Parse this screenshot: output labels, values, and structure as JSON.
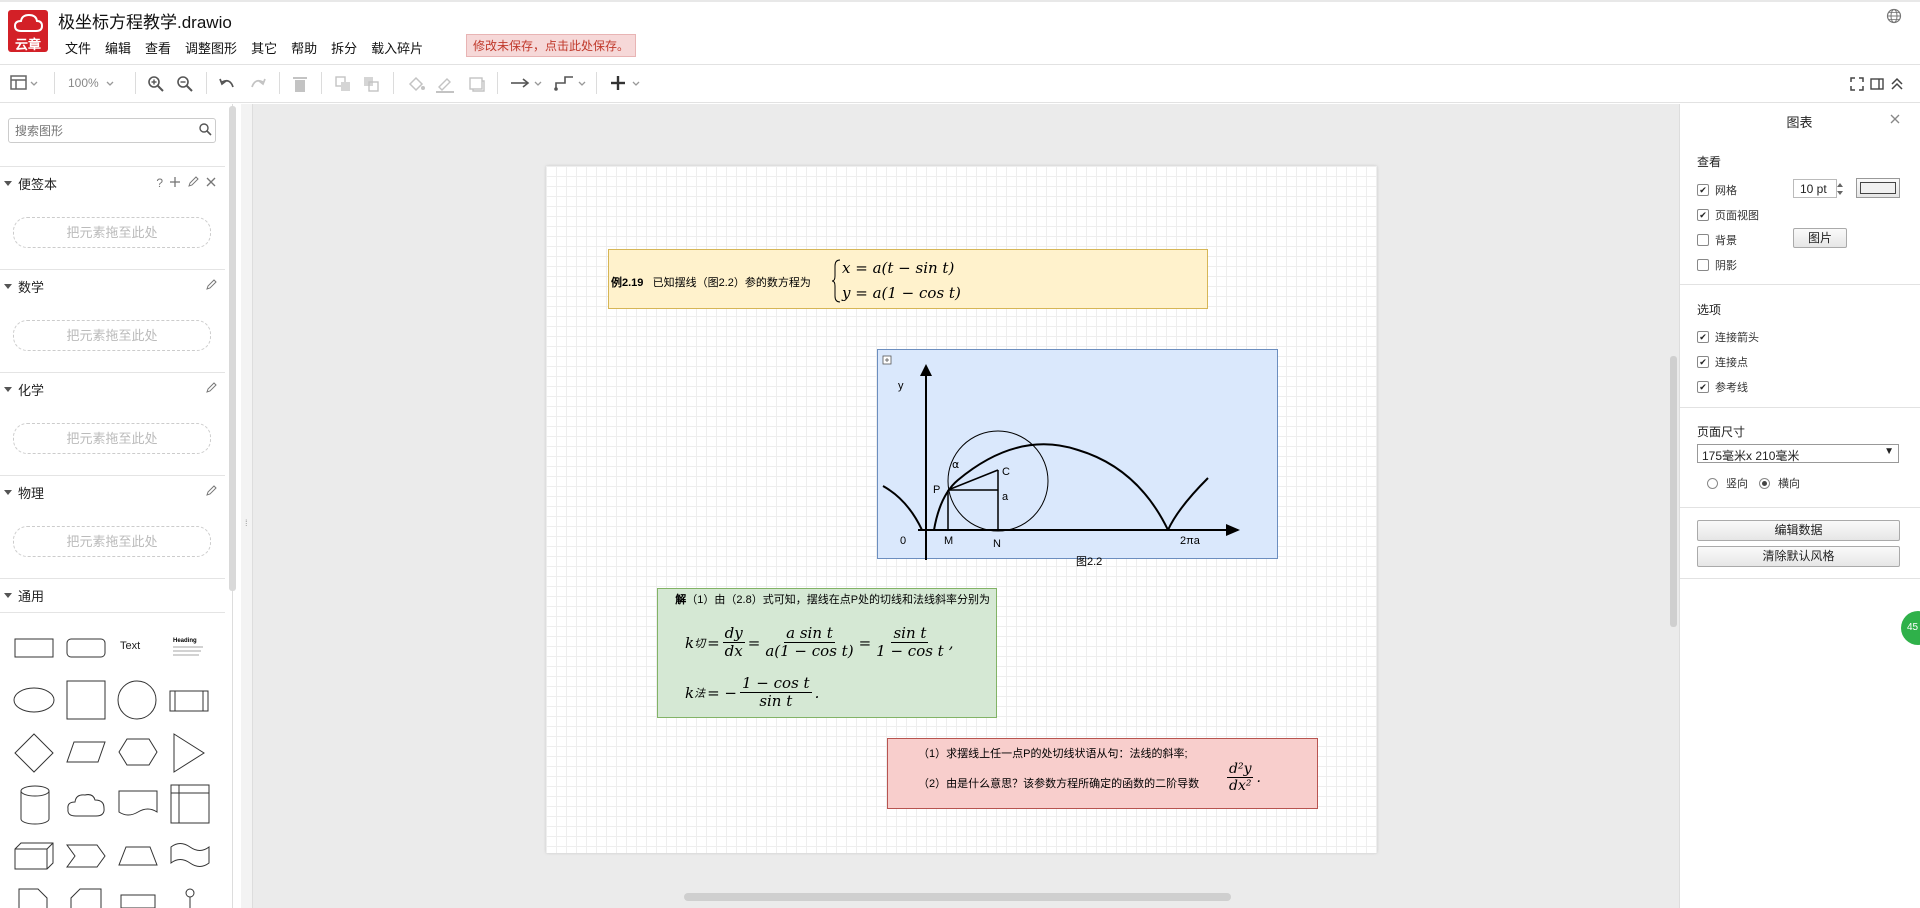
{
  "app": {
    "logo_text": "云章",
    "title": "极坐标方程教学.drawio",
    "unsaved_notice": "修改未保存，点击此处保存。"
  },
  "menu": [
    "文件",
    "编辑",
    "查看",
    "调整图形",
    "其它",
    "帮助",
    "拆分",
    "载入碎片"
  ],
  "toolbar": {
    "zoom": "100%"
  },
  "sidebar": {
    "search_placeholder": "搜索图形",
    "drop_text": "把元素拖至此处",
    "sections": {
      "scratchpad": "便签本",
      "math": "数学",
      "chemistry": "化学",
      "physics": "物理",
      "general": "通用"
    },
    "scratchpad_help": "?",
    "shape_text": "Text",
    "shape_heading": "Heading"
  },
  "diagram": {
    "example": {
      "label": "例2.19",
      "text": "已知摆线（图2.2）参的数方程为",
      "eq1": "x = a(t − sin t)",
      "eq2": "y = a(1 − cos t)"
    },
    "figure": {
      "caption": "图2.2",
      "y_label": "y",
      "origin": "0",
      "m": "M",
      "n": "N",
      "p": "P",
      "c": "C",
      "a": "a",
      "alpha": "α",
      "two_pi_a": "2πa"
    },
    "solution": {
      "lead": "解",
      "text": "（1）由（2.8）式可知，摆线在点P处的切线和法线斜率分别为",
      "k1": "k",
      "k1_sub": "切",
      "k2_sub": "法",
      "dy": "dy",
      "dx": "dx",
      "asint": "a sin t",
      "a1cost": "a(1 − cos t)",
      "sint": "sin t",
      "onecost": "1 − cos t",
      "onecost2": "1 − cos t",
      "sint2": "sin t"
    },
    "questions": {
      "q1": "（1）求摆线上任一点P的处切线状语从句：法线的斜率;",
      "q2": "（2）由是什么意思？该参数方程所确定的函数的二阶导数",
      "d2y": "d²y",
      "dx2": "dx²"
    }
  },
  "right_panel": {
    "title": "图表",
    "view_header": "查看",
    "grid": "网格",
    "grid_size": "10 pt",
    "page_view": "页面视图",
    "background": "背景",
    "image_btn": "图片",
    "shadow": "阴影",
    "options_header": "选项",
    "connection_arrows": "连接箭头",
    "connection_points": "连接点",
    "guides": "参考线",
    "page_size_header": "页面尺寸",
    "page_size": "175毫米x 210毫米",
    "portrait": "竖向",
    "landscape": "横向",
    "edit_data": "编辑数据",
    "clear_style": "清除默认风格",
    "checks": {
      "grid": true,
      "page_view": true,
      "background": false,
      "shadow": false,
      "arrows": true,
      "points": true,
      "guides": true
    },
    "orientation": "landscape"
  },
  "float_badge": "45"
}
